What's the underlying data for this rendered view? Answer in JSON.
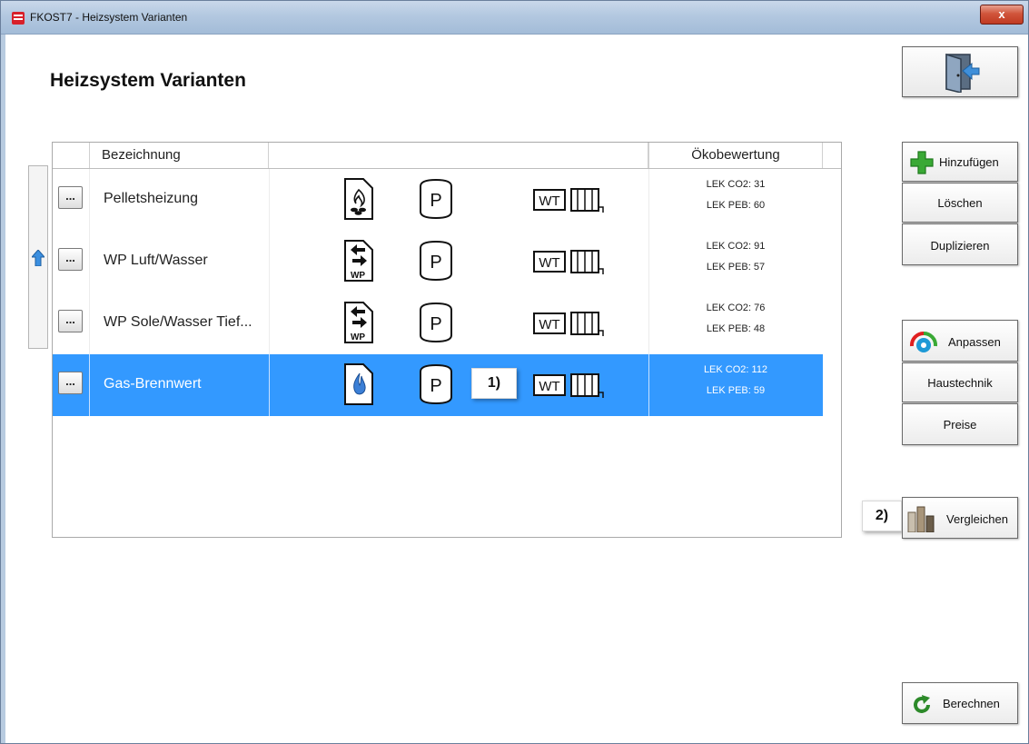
{
  "window": {
    "title": "FKOST7 - Heizsystem Varianten",
    "close_label": "x"
  },
  "page": {
    "title": "Heizsystem Varianten"
  },
  "table": {
    "columns": {
      "bezeichnung": "Bezeichnung",
      "middle": "",
      "oekobewertung": "Ökobewertung"
    },
    "rows": [
      {
        "more_label": "...",
        "name": "Pelletsheizung",
        "generator_icon": "pellet-heater-icon",
        "storage_label": "P",
        "wt_label": "WT",
        "co2": "LEK CO2: 31",
        "peb": "LEK PEB: 60",
        "selected": false
      },
      {
        "more_label": "...",
        "name": "WP Luft/Wasser",
        "generator_icon": "heat-pump-icon",
        "generator_sub": "WP",
        "storage_label": "P",
        "wt_label": "WT",
        "co2": "LEK CO2: 91",
        "peb": "LEK PEB: 57",
        "selected": false
      },
      {
        "more_label": "...",
        "name": "WP Sole/Wasser Tief...",
        "generator_icon": "heat-pump-icon",
        "generator_sub": "WP",
        "storage_label": "P",
        "wt_label": "WT",
        "co2": "LEK CO2: 76",
        "peb": "LEK PEB: 48",
        "selected": false
      },
      {
        "more_label": "...",
        "name": "Gas-Brennwert",
        "generator_icon": "gas-flame-icon",
        "storage_label": "P",
        "wt_label": "WT",
        "co2": "LEK CO2: 112",
        "peb": "LEK PEB: 59",
        "selected": true
      }
    ]
  },
  "markers": {
    "m1": "1)",
    "m2": "2)"
  },
  "buttons": {
    "hinzufuegen": "Hinzufügen",
    "loeschen": "Löschen",
    "duplizieren": "Duplizieren",
    "anpassen": "Anpassen",
    "haustechnik": "Haustechnik",
    "preise": "Preise",
    "vergleichen": "Vergleichen",
    "berechnen": "Berechnen"
  },
  "colors": {
    "selection": "#3399ff",
    "accent_green": "#3aa935",
    "title_bar": "#b3c8e0",
    "close": "#c9462c"
  }
}
